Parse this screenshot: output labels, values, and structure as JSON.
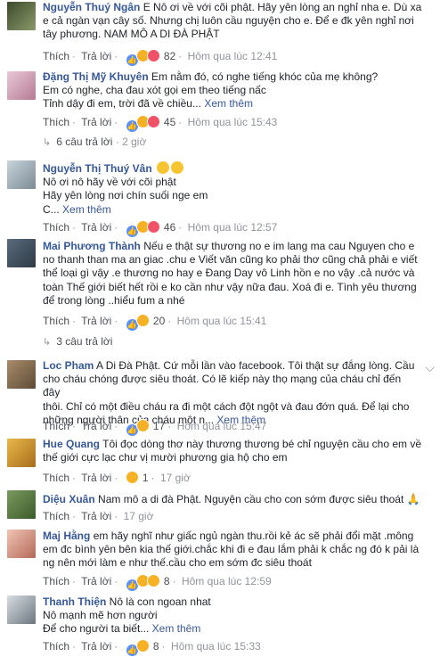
{
  "labels": {
    "like": "Thích",
    "reply": "Trả lời",
    "see_more": "Xem thêm",
    "ellipsis": "..."
  },
  "comments": [
    {
      "name": "Nguyễn Thuý Ngân",
      "text_lines": [
        "E Nô ơi về với cõi phật. Hãy yên lòng an nghỉ nha e. Dù xa",
        "e cả ngàn vạn cây số. Nhưng chị luôn cầu nguyện cho e. Để e đk yên nghỉ nơi",
        "tây phương. NAM MÔ A DI ĐÀ PHẬT"
      ],
      "reaction_count": "82",
      "time": "Hôm qua lúc 12:41"
    },
    {
      "name": "Đặng Thị Mỹ Khuyên",
      "text_lines": [
        "Em nằm đó, có nghe tiếng khóc của mẹ không?",
        "Em có nghe, cha đau xót gọi em theo tiếng nấc",
        "Tỉnh dậy đi em, trời đã về chiều"
      ],
      "see_more": true,
      "reaction_count": "45",
      "time": "Hôm qua lúc 15:43",
      "replies": "6 câu trả lời",
      "replies_time": "2 giờ"
    },
    {
      "name": "Nguyễn Thị Thuý Vân",
      "text_lines": [
        "",
        "Nô ơi nô hãy về với cõi phật",
        "Hãy yên lòng nơi chín suối nge em",
        "C"
      ],
      "see_more": true,
      "reaction_count": "46",
      "time": "Hôm qua lúc 12:57"
    },
    {
      "name": "Mai Phương Thành",
      "text_lines": [
        "Nếu e thật sự thương no e im lang ma cau Nguyen cho e",
        "no thanh than ma an giac .chu e Viết văn cũng ko phải thơ cũng chả phải e viết",
        "thể loại gì vậy .e thương no hay e Đang Day vô Linh hồn e no vậy .cả nước và",
        "toàn Thế giới biết hết rồi e ko cần như vậy nữa đau. Xoá đi e. Tình yêu thương",
        "để trong lòng ..hiểu fum a nhé"
      ],
      "reaction_count": "20",
      "time": "Hôm qua lúc 15:41",
      "replies": "3 câu trả lời"
    },
    {
      "name": "Loc Pham",
      "text_lines": [
        "A Di Đà Phật. Cứ mỗi lần vào facebook. Tôi thật sự đắng lòng. Cầu",
        "cho cháu chóng được siêu thoát. Có lẽ kiếp này thọ mạng của cháu chỉ đến đây",
        "thôi. Chỉ có một điều cháu ra đi một cách đột ngột và đau đớn quá. Để lại cho",
        "những người thân của cháu một n"
      ],
      "see_more": true,
      "reaction_count": "17",
      "time": "Hôm qua lúc 15:47"
    },
    {
      "name": "Hue Quang",
      "text_lines": [
        "Tôi đọc dòng thơ này thương thương bé chỉ nguyện cầu cho em về",
        "thế giới cực lạc chư vị mười phương gia hộ cho em"
      ],
      "reaction_count": "1",
      "time": "17 giờ"
    },
    {
      "name": "Diệu Xuân",
      "text_lines": [
        "Nam mô a di đà Phật. Nguyện cầu cho con sớm được siêu thoát"
      ],
      "time": "17 giờ"
    },
    {
      "name": "Maj Hằng",
      "text_lines": [
        "em hãy nghĩ như giấc ngủ ngàn thu.rồi kẻ ác sẽ phải đổi mặt .mông",
        "em đc bình yên bên kia thế giới.chắc khi đi e đau lắm phải k chắc ng đó k pải là",
        "ng nên mới làm e như thế.cầu cho em sớm đc siêu thoát"
      ],
      "reaction_count": "8",
      "time": "Hôm qua lúc 12:59"
    },
    {
      "name": "Thanh Thiện",
      "text_lines": [
        "Nô là con ngoan nhat",
        "Nô mạnh mẽ hơn người",
        "Để cho người ta biết"
      ],
      "see_more": true,
      "reaction_count": "8",
      "time": "Hôm qua lúc 15:33"
    }
  ]
}
